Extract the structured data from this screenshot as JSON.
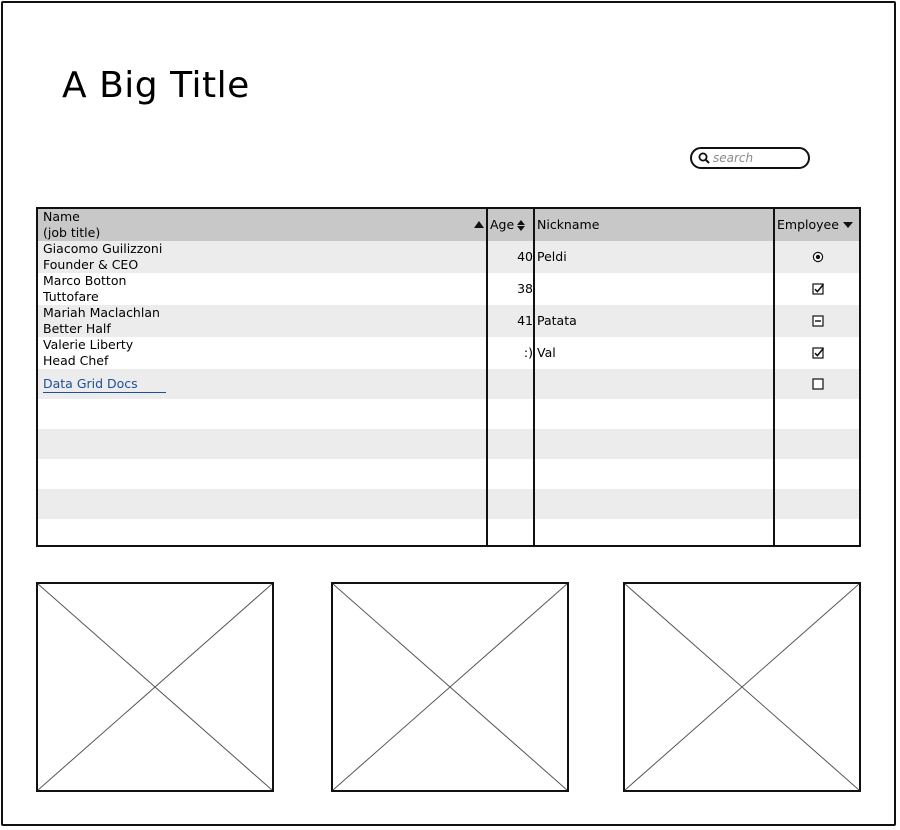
{
  "page": {
    "title": "A Big Title"
  },
  "search": {
    "placeholder": "search",
    "value": ""
  },
  "grid": {
    "columns": {
      "name_line1": "Name",
      "name_line2": "(job title)",
      "age": "Age",
      "nickname": "Nickname",
      "employee": "Employee"
    },
    "rows": [
      {
        "name": "Giacomo Guilizzoni",
        "title": "Founder & CEO",
        "age": "40",
        "nickname": "Peldi",
        "employee": "radio-selected"
      },
      {
        "name": "Marco Botton",
        "title": "Tuttofare",
        "age": "38",
        "nickname": "",
        "employee": "checked"
      },
      {
        "name": "Mariah Maclachlan",
        "title": "Better Half",
        "age": "41",
        "nickname": "Patata",
        "employee": "indeterminate"
      },
      {
        "name": "Valerie Liberty",
        "title": "Head Chef",
        "age": ":)",
        "nickname": "Val",
        "employee": "checked"
      },
      {
        "name": "Data Grid Docs",
        "title": "",
        "age": "",
        "nickname": "",
        "employee": "unchecked",
        "is_link": true
      }
    ],
    "empty_rows": 5
  },
  "image_placeholders": [
    "image-placeholder-1",
    "image-placeholder-2",
    "image-placeholder-3"
  ]
}
